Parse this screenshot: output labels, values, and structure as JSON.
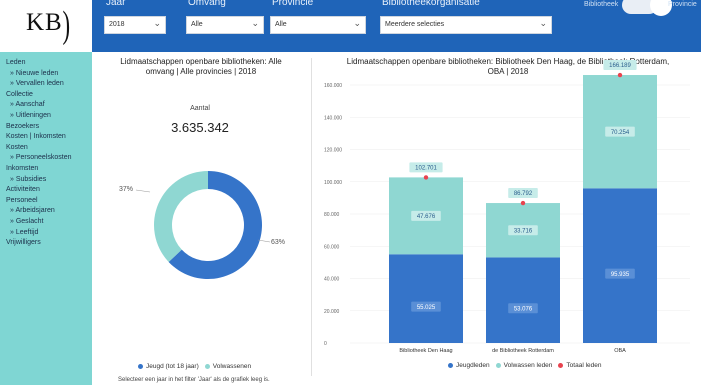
{
  "logo": {
    "text": "KB",
    "bracket": ")"
  },
  "filters": {
    "jaar": {
      "label": "Jaar",
      "value": "2018"
    },
    "omvang": {
      "label": "Omvang",
      "value": "Alle"
    },
    "provincie": {
      "label": "Provincie",
      "value": "Alle"
    },
    "organisatie": {
      "label": "Bibliotheekorganisatie",
      "value": "Meerdere selecties"
    },
    "toggle_left": "Bibliotheek",
    "toggle_right": "Provincie",
    "chevron": "chevron-down-icon"
  },
  "sidebar": {
    "items": [
      {
        "label": "Leden",
        "sub": false
      },
      {
        "label": "» Nieuwe leden",
        "sub": true
      },
      {
        "label": "» Vervallen leden",
        "sub": true
      },
      {
        "label": "Collectie",
        "sub": false
      },
      {
        "label": "» Aanschaf",
        "sub": true
      },
      {
        "label": "» Uitleningen",
        "sub": true
      },
      {
        "label": "Bezoekers",
        "sub": false
      },
      {
        "label": "Kosten | Inkomsten",
        "sub": false
      },
      {
        "label": "Kosten",
        "sub": false
      },
      {
        "label": "» Personeelskosten",
        "sub": true
      },
      {
        "label": "Inkomsten",
        "sub": false
      },
      {
        "label": "» Subsidies",
        "sub": true
      },
      {
        "label": "Activiteiten",
        "sub": false
      },
      {
        "label": "Personeel",
        "sub": false
      },
      {
        "label": "» Arbeidsjaren",
        "sub": true
      },
      {
        "label": "» Geslacht",
        "sub": true
      },
      {
        "label": "» Leeftijd",
        "sub": true
      },
      {
        "label": "Vrijwilligers",
        "sub": false
      }
    ]
  },
  "left_panel": {
    "title_line1": "Lidmaatschappen openbare bibliotheken: Alle",
    "title_line2": "omvang | Alle provincies | 2018",
    "kpi_label": "Aantal",
    "kpi_value": "3.635.342",
    "note": "Selecteer een jaar in het filter 'Jaar' als de grafiek leeg is."
  },
  "right_panel": {
    "title_line1": "Lidmaatschappen openbare bibliotheken: Bibliotheek Den Haag, de Bibliotheek Rotterdam,",
    "title_line2": "OBA | 2018"
  },
  "chart_data": [
    {
      "type": "pie",
      "categories": [
        "Jeugd (tot 18 jaar)",
        "Volwassenen"
      ],
      "values": [
        63,
        37
      ],
      "data_labels": [
        "63%",
        "37%"
      ],
      "colors": [
        "#3574c9",
        "#8fd7d2"
      ],
      "legend": "bottom"
    },
    {
      "type": "bar",
      "stacked": true,
      "categories": [
        "Bibliotheek Den Haag",
        "de Bibliotheek Rotterdam",
        "OBA"
      ],
      "series": [
        {
          "name": "Jeugdleden",
          "values": [
            55025,
            53076,
            95935
          ],
          "labels": [
            "55.025",
            "53.076",
            "95.935"
          ],
          "color": "#3574c9"
        },
        {
          "name": "Volwassen leden",
          "values": [
            47676,
            33716,
            70254
          ],
          "labels": [
            "47.676",
            "33.716",
            "70.254"
          ],
          "color": "#8fd7d2"
        },
        {
          "name": "Totaal leden",
          "values": [
            102701,
            86792,
            166189
          ],
          "labels": [
            "102.701",
            "86.792",
            "166.189"
          ],
          "color": "#e8434f",
          "marker": "dot"
        }
      ],
      "yticks": [
        "0",
        "20.000",
        "40.000",
        "60.000",
        "80.000",
        "100.000",
        "120.000",
        "140.000",
        "160.000"
      ],
      "ylim": [
        0,
        180000
      ],
      "legend": "bottom"
    }
  ]
}
